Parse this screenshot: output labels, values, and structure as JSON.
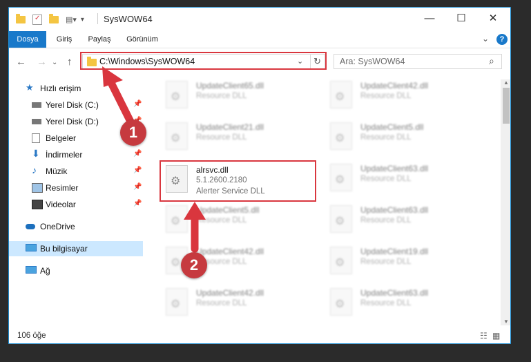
{
  "window": {
    "title": "SysWOW64",
    "minimize": "—",
    "maximize": "☐",
    "close": "✕"
  },
  "ribbon": {
    "tabs": [
      "Dosya",
      "Giriş",
      "Paylaş",
      "Görünüm"
    ],
    "expand": "⌄",
    "help": "?"
  },
  "nav": {
    "back": "←",
    "forward": "→",
    "recent": "⌄",
    "up": "↑",
    "address": "C:\\Windows\\SysWOW64",
    "address_dropdown": "⌄",
    "refresh": "↻",
    "search_placeholder": "Ara: SysWOW64",
    "search_icon": "⌕"
  },
  "sidebar": {
    "items": [
      {
        "label": "Hızlı erişim",
        "icon": "star-icon",
        "pinned": false
      },
      {
        "label": "Yerel Disk (C:)",
        "icon": "drive-icon",
        "pinned": true
      },
      {
        "label": "Yerel Disk (D:)",
        "icon": "drive-icon",
        "pinned": true
      },
      {
        "label": "Belgeler",
        "icon": "documents-icon",
        "pinned": true
      },
      {
        "label": "İndirmeler",
        "icon": "download-icon",
        "pinned": true
      },
      {
        "label": "Müzik",
        "icon": "music-icon",
        "pinned": true
      },
      {
        "label": "Resimler",
        "icon": "pictures-icon",
        "pinned": true
      },
      {
        "label": "Videolar",
        "icon": "videos-icon",
        "pinned": true
      },
      {
        "label": "OneDrive",
        "icon": "onedrive-icon",
        "pinned": false
      },
      {
        "label": "Bu bilgisayar",
        "icon": "computer-icon",
        "pinned": false
      },
      {
        "label": "Ağ",
        "icon": "network-icon",
        "pinned": false
      }
    ],
    "pin_glyph": "📌"
  },
  "files": {
    "highlighted": {
      "name": "alrsvc.dll",
      "version": "5.1.2600.2180",
      "description": "Alerter Service DLL"
    },
    "blurred": [
      {
        "name": "UpdateClient65.dll",
        "type": "Resource DLL"
      },
      {
        "name": "UpdateClient42.dll",
        "type": "Resource DLL"
      },
      {
        "name": "UpdateClient21.dll",
        "type": "Resource DLL"
      },
      {
        "name": "UpdateClient5.dll",
        "type": "Resource DLL"
      },
      {
        "name": "UpdateClient63.dll",
        "type": "Resource DLL"
      },
      {
        "name": "UpdateClient5.dll",
        "type": "Resource DLL"
      },
      {
        "name": "UpdateClient63.dll",
        "type": "Resource DLL"
      },
      {
        "name": "UpdateClient42.dll",
        "type": "Resource DLL"
      },
      {
        "name": "UpdateClient19.dll",
        "type": "Resource DLL"
      },
      {
        "name": "UpdateClient42.dll",
        "type": "Resource DLL"
      },
      {
        "name": "UpdateClient63.dll",
        "type": "Resource DLL"
      }
    ]
  },
  "status": {
    "count": "106 öğe"
  },
  "badges": {
    "one": "1",
    "two": "2"
  },
  "colors": {
    "accent": "#1979ca",
    "highlight": "#d9363e",
    "selected": "#cce8ff"
  }
}
